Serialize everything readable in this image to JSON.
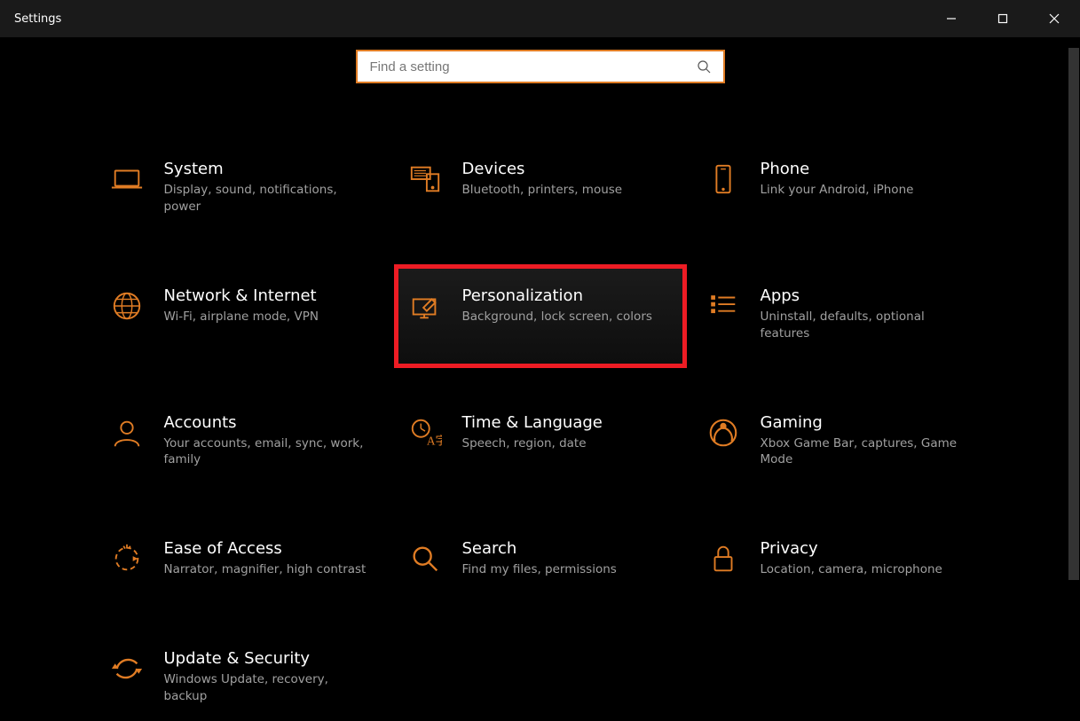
{
  "window": {
    "title": "Settings"
  },
  "search": {
    "placeholder": "Find a setting"
  },
  "categories": [
    {
      "id": "system",
      "title": "System",
      "desc": "Display, sound, notifications, power",
      "icon": "laptop-icon",
      "highlighted": false
    },
    {
      "id": "devices",
      "title": "Devices",
      "desc": "Bluetooth, printers, mouse",
      "icon": "devices-icon",
      "highlighted": false
    },
    {
      "id": "phone",
      "title": "Phone",
      "desc": "Link your Android, iPhone",
      "icon": "phone-icon",
      "highlighted": false
    },
    {
      "id": "network",
      "title": "Network & Internet",
      "desc": "Wi-Fi, airplane mode, VPN",
      "icon": "globe-icon",
      "highlighted": false
    },
    {
      "id": "personalization",
      "title": "Personalization",
      "desc": "Background, lock screen, colors",
      "icon": "personalization-icon",
      "highlighted": true
    },
    {
      "id": "apps",
      "title": "Apps",
      "desc": "Uninstall, defaults, optional features",
      "icon": "apps-icon",
      "highlighted": false
    },
    {
      "id": "accounts",
      "title": "Accounts",
      "desc": "Your accounts, email, sync, work, family",
      "icon": "accounts-icon",
      "highlighted": false
    },
    {
      "id": "time",
      "title": "Time & Language",
      "desc": "Speech, region, date",
      "icon": "time-language-icon",
      "highlighted": false
    },
    {
      "id": "gaming",
      "title": "Gaming",
      "desc": "Xbox Game Bar, captures, Game Mode",
      "icon": "gaming-icon",
      "highlighted": false
    },
    {
      "id": "ease",
      "title": "Ease of Access",
      "desc": "Narrator, magnifier, high contrast",
      "icon": "ease-of-access-icon",
      "highlighted": false
    },
    {
      "id": "search-cat",
      "title": "Search",
      "desc": "Find my files, permissions",
      "icon": "search-category-icon",
      "highlighted": false
    },
    {
      "id": "privacy",
      "title": "Privacy",
      "desc": "Location, camera, microphone",
      "icon": "privacy-icon",
      "highlighted": false
    },
    {
      "id": "update",
      "title": "Update & Security",
      "desc": "Windows Update, recovery, backup",
      "icon": "update-icon",
      "highlighted": false
    }
  ],
  "colors": {
    "accent": "#e07c24",
    "highlight_border": "#ed1c24"
  }
}
